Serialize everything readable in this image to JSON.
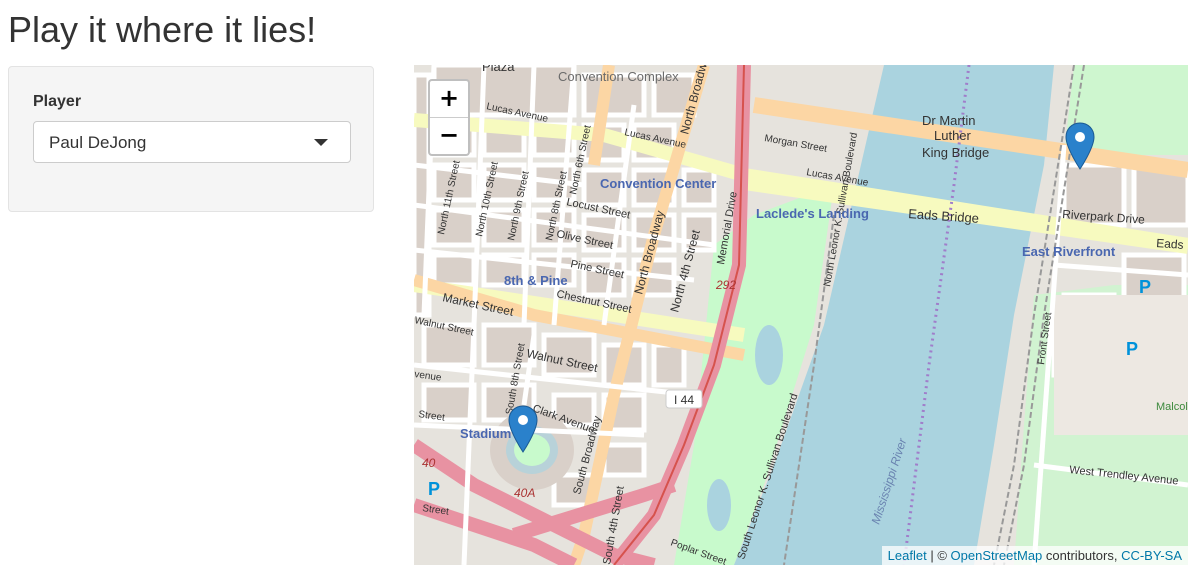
{
  "page": {
    "title": "Play it where it lies!"
  },
  "sidebar": {
    "player_label": "Player",
    "player_value": "Paul DeJong"
  },
  "map": {
    "zoom_in": "+",
    "zoom_out": "−",
    "attribution": {
      "leaflet": "Leaflet",
      "sep": " | © ",
      "osm": "OpenStreetMap",
      "contributors": " contributors, ",
      "license": "CC-BY-SA"
    },
    "markers": 2,
    "labels": {
      "convention_complex": "Convention Complex",
      "convention_center": "Convention Center",
      "lacledes_landing": "Laclede's Landing",
      "east_riverfront": "East Riverfront",
      "eighth_pine": "8th & Pine",
      "stadium": "Stadium",
      "mlk_bridge_1": "Dr Martin",
      "mlk_bridge_2": "Luther",
      "mlk_bridge_3": "King Bridge",
      "eads_bridge": "Eads Bridge",
      "eads_cut": "Eads",
      "riverpark_drive": "Riverpark Drive",
      "market_street": "Market Street",
      "walnut_street": "Walnut Street",
      "walnut_street_w": "Walnut Street",
      "chestnut_street": "Chestnut Street",
      "pine_street": "Pine Street",
      "olive_street": "Olive Street",
      "locust_street": "Locust Street",
      "lucas_avenue": "Lucas Avenue",
      "lucas_avenue_e": "Lucas Avenue",
      "lucas_avenue_ne": "Lucas Avenue",
      "morgan_street": "Morgan Street",
      "north_broadway": "North Broadway",
      "north_broadway_top": "North Broadway",
      "north_4th": "North 4th Street",
      "memorial_drive": "Memorial Drive",
      "south_broadway": "South Broadway",
      "south_4th": "South 4th Street",
      "leonor": "South Leonor K. Sullivan Boulevard",
      "leonor_n": "North Leonor K. Sullivan Boulevard",
      "clark_avenue": "Clark Avenue",
      "poplar": "Poplar Street",
      "street": "Street",
      "avenue": "venue",
      "west_trendley": "West Trendley Avenue",
      "front_street": "Front Street",
      "mississippi": "Mississippi River",
      "i44": "I 44",
      "r292": "292",
      "r40": "40",
      "r40a": "40A",
      "plaza": "Plaza",
      "malcolm": "Malcolm W. Martin Memorial Park",
      "n11": "North 11th Street",
      "n10": "North 10th Street",
      "n9": "North 9th Street",
      "n8": "North 8th Street",
      "n6": "North 6th Street",
      "s8": "South 8th Street",
      "p": "P"
    }
  }
}
